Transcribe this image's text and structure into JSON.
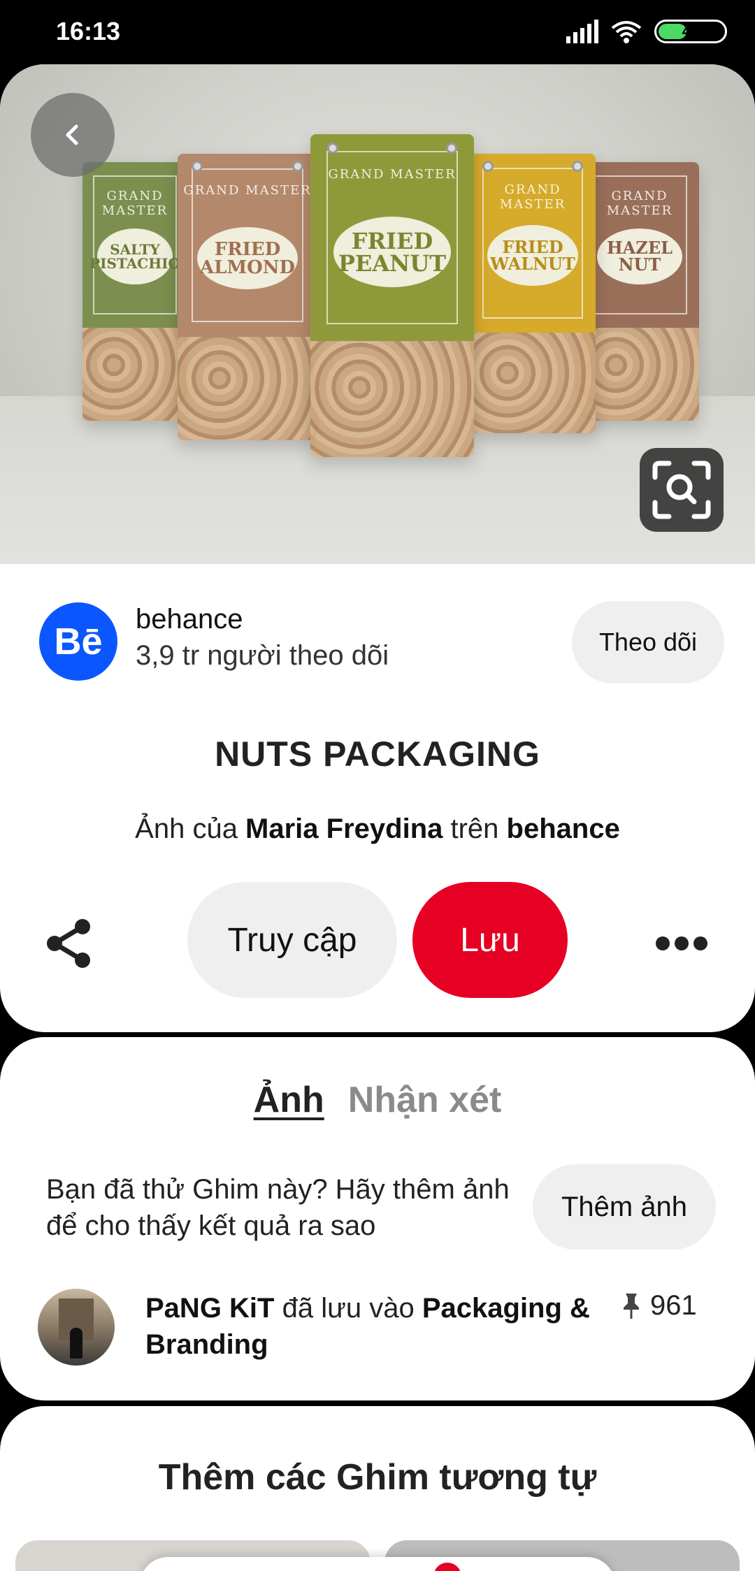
{
  "status_bar": {
    "time": "16:13",
    "battery": "44"
  },
  "hero": {
    "back_icon": "chevron-left-icon",
    "lens_icon": "visual-search-icon",
    "bags": [
      {
        "brand": "GRAND MASTER",
        "label": "SALTY PISTACHIO",
        "color": "#7d8f4f"
      },
      {
        "brand": "GRAND MASTER",
        "label": "FRIED ALMOND",
        "color": "#b4886a"
      },
      {
        "brand": "GRAND MASTER",
        "label": "FRIED PEANUT",
        "color": "#8e9a3a"
      },
      {
        "brand": "GRAND MASTER",
        "label": "FRIED WALNUT",
        "color": "#d6aa2a"
      },
      {
        "brand": "GRAND MASTER",
        "label": "HAZEL NUT",
        "color": "#9a6f5a"
      }
    ]
  },
  "creator": {
    "avatar_text": "Bē",
    "name": "behance",
    "followers": "3,9 tr người theo dõi",
    "follow_label": "Theo dõi"
  },
  "pin": {
    "title": "NUTS PACKAGING",
    "attr_prefix": "Ảnh của ",
    "attr_author": "Maria Freydina",
    "attr_mid": " trên ",
    "attr_source": "behance"
  },
  "actions": {
    "visit_label": "Truy cập",
    "save_label": "Lưu",
    "share_icon": "share-icon",
    "more_icon": "more-icon"
  },
  "photos": {
    "tab_photos": "Ảnh",
    "tab_comments": "Nhận xét",
    "tried_text": "Bạn đã thử Ghim này? Hãy thêm ảnh để cho thấy kết quả ra sao",
    "add_photo_label": "Thêm ảnh",
    "saver_name": "PaNG KiT",
    "saver_mid": " đã lưu vào ",
    "saver_board": "Packaging & Branding",
    "pin_count": "961"
  },
  "more": {
    "title": "Thêm các Ghim tương tự"
  },
  "colors": {
    "save_red": "#e60023",
    "behance_blue": "#0b57ff"
  }
}
